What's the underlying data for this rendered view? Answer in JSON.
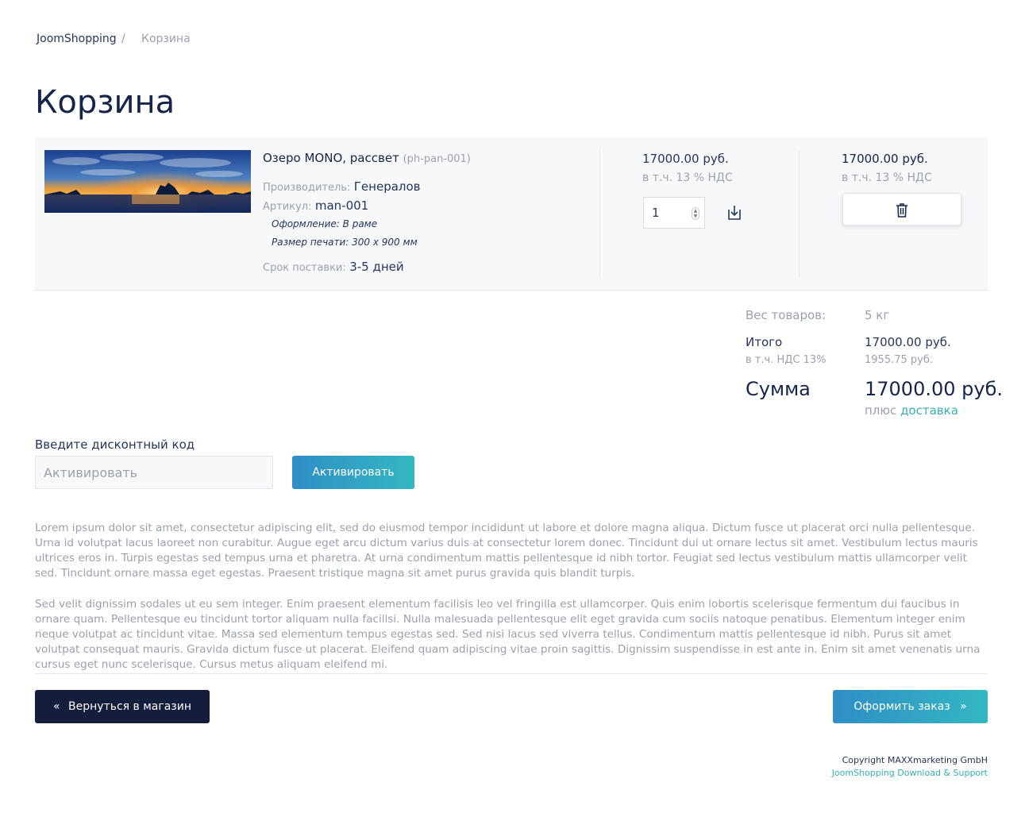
{
  "breadcrumb": {
    "home": "JoomShopping",
    "separator": "/",
    "current": "Корзина"
  },
  "page_title": "Корзина",
  "cart": {
    "item": {
      "name": "Озеро MONO, рассвет",
      "code": "(ph-pan-001)",
      "manufacturer_label": "Производитель:",
      "manufacturer": "Генералов",
      "sku_label": "Артикул:",
      "sku": "man-001",
      "extra1": "Оформление: В раме",
      "extra2": "Размер печати: 300 x 900 мм",
      "delivery_label": "Срок поставки:",
      "delivery": "3-5 дней",
      "price": "17000.00 руб.",
      "price_vat": "в т.ч. 13 % НДС",
      "quantity": "1",
      "total": "17000.00 руб.",
      "total_vat": "в т.ч. 13 % НДС"
    }
  },
  "totals": {
    "weight_label": "Вес товаров:",
    "weight": "5 кг",
    "subtotal_label": "Итого",
    "subtotal": "17000.00 руб.",
    "vat_label": "в т.ч. НДС 13%",
    "vat": "1955.75 руб.",
    "sum_label": "Сумма",
    "sum": "17000.00 руб.",
    "plus": "плюс",
    "delivery_link": "доставка"
  },
  "discount": {
    "label": "Введите дисконтный код",
    "placeholder": "Активировать",
    "button": "Активировать"
  },
  "text": {
    "p1": "Lorem ipsum dolor sit amet, consectetur adipiscing elit, sed do eiusmod tempor incididunt ut labore et dolore magna aliqua. Dictum fusce ut placerat orci nulla pellentesque. Urna id volutpat lacus laoreet non curabitur. Augue eget arcu dictum varius duis at consectetur lorem donec. Tincidunt dui ut ornare lectus sit amet. Vestibulum lectus mauris ultrices eros in. Turpis egestas sed tempus urna et pharetra. At urna condimentum mattis pellentesque id nibh tortor. Feugiat sed lectus vestibulum mattis ullamcorper velit sed. Tincidunt ornare massa eget egestas. Praesent tristique magna sit amet purus gravida quis blandit turpis.",
    "p2": "Sed velit dignissim sodales ut eu sem integer. Enim praesent elementum facilisis leo vel fringilla est ullamcorper. Quis enim lobortis scelerisque fermentum dui faucibus in ornare quam. Pellentesque eu tincidunt tortor aliquam nulla facilisi. Nulla malesuada pellentesque elit eget gravida cum sociis natoque penatibus. Elementum integer enim neque volutpat ac tincidunt vitae. Massa sed elementum tempus egestas sed. Sed nisi lacus sed viverra tellus. Condimentum mattis pellentesque id nibh. Purus sit amet volutpat consequat mauris. Gravida dictum fusce ut placerat. Eleifend quam adipiscing vitae proin sagittis. Dignissim suspendisse in est ante in. Enim sit amet venenatis urna cursus eget nunc scelerisque. Cursus metus aliquam eleifend mi."
  },
  "actions": {
    "back": "Вернуться в магазин",
    "back_icon": "«",
    "order": "Оформить заказ",
    "order_icon": "»"
  },
  "footer": {
    "copyright": "Copyright MAXXmarketing GmbH",
    "support": "JoomShopping Download & Support"
  },
  "colors": {
    "navy": "#14244a",
    "teal": "#34b1b8",
    "accent_start": "#2f8ec6",
    "dark_button": "#141d3b"
  }
}
